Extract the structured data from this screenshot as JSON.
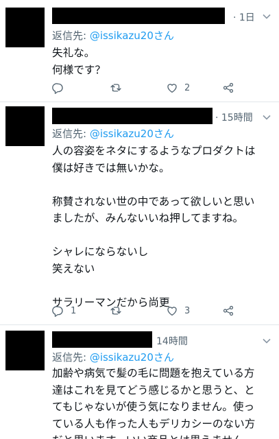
{
  "tweets": [
    {
      "time": "· 1日",
      "reply_prefix": "返信先: ",
      "reply_handle": "@issikazu20さん",
      "text": "失礼な。\n何様です？",
      "reply_count": "",
      "retweet_count": "",
      "like_count": "2"
    },
    {
      "time": "· 15時間",
      "reply_prefix": "返信先: ",
      "reply_handle": "@issikazu20さん",
      "text": "人の容姿をネタにするようなプロダクトは\n僕は好きでは無いかな。\n\n称賛されない世の中であって欲しいと思い\nましたが、みんないいね押してますね。\n\nシャレにならないし\n笑えない\n\nサラリーマンだから尚更",
      "reply_count": "1",
      "retweet_count": "",
      "like_count": "3"
    },
    {
      "time": "14時間",
      "reply_prefix": "返信先: ",
      "reply_handle": "@issikazu20さん",
      "text": "加齢や病気で髪の毛に問題を抱えている方\n達はこれを見てどう感じるかと思うと、と\nてもじゃないが使う気になりません。使っ\nている人も作った人もデリカシーのない方\nだと思います。いい商品とは思えません。"
    }
  ],
  "icons": {
    "reply": "reply-icon",
    "retweet": "retweet-icon",
    "like": "heart-icon",
    "share": "share-icon",
    "more": "chevron-down-icon"
  },
  "colors": {
    "link": "#1d9bf0",
    "secondary_text": "#536471",
    "divider": "#e1e6ea"
  }
}
